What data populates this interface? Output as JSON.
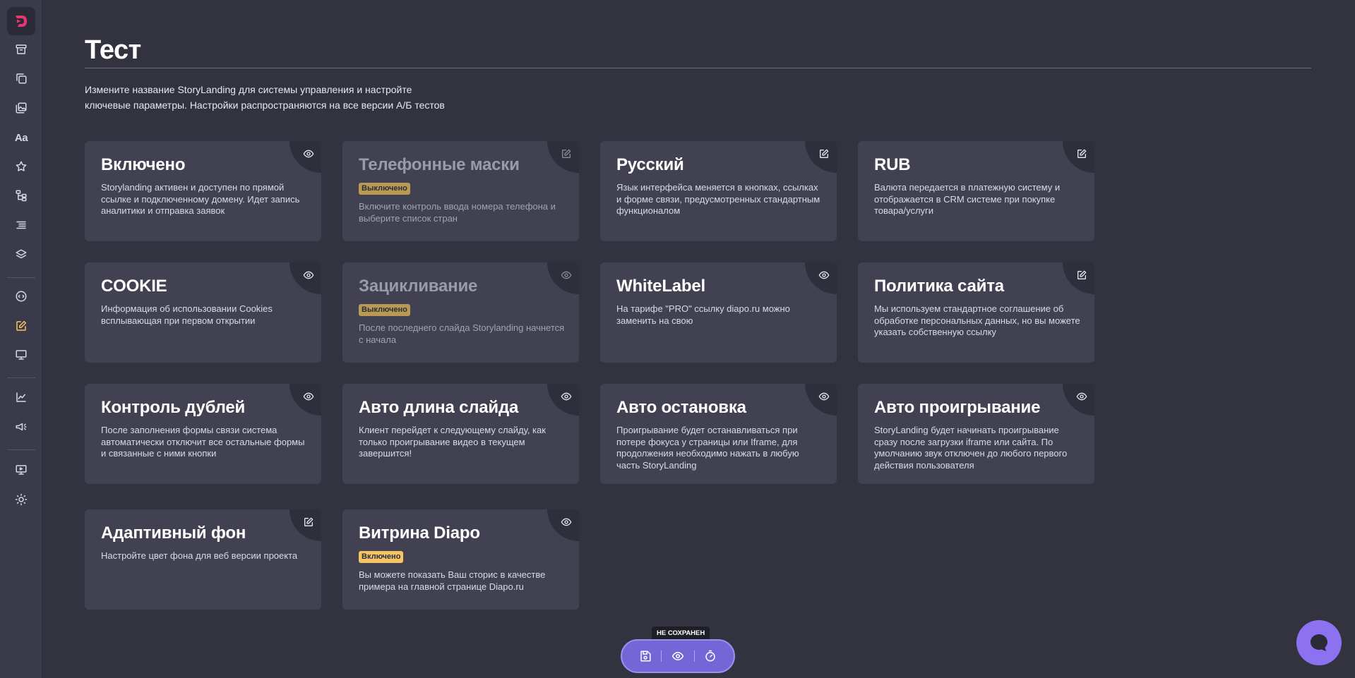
{
  "page": {
    "title": "Тест",
    "description": "Измените название StoryLanding для системы управления и настройте ключевые параметры. Настройки распространяются на все версии А/Б тестов"
  },
  "sidebar": {
    "items": [
      {
        "icon": "archive-icon"
      },
      {
        "icon": "copy-icon"
      },
      {
        "icon": "images-icon"
      },
      {
        "icon": "typography-icon",
        "text": "Aa"
      },
      {
        "icon": "star-icon"
      },
      {
        "icon": "tree-icon"
      },
      {
        "icon": "list-icon"
      },
      {
        "icon": "layers-icon"
      },
      {
        "icon": "code-icon"
      },
      {
        "icon": "edit-icon",
        "active": true
      },
      {
        "icon": "monitor-icon"
      },
      {
        "icon": "chart-icon"
      },
      {
        "icon": "megaphone-icon"
      },
      {
        "icon": "presentation-icon"
      },
      {
        "icon": "sun-icon"
      }
    ]
  },
  "cards": [
    {
      "title": "Включено",
      "desc": "Storylanding активен и доступен по прямой ссылке и подключенному домену. Идет запись аналитики и отправка заявок",
      "action": "eye-icon"
    },
    {
      "title": "Телефонные маски",
      "badge": "Выключено",
      "desc": "Включите контроль ввода номера телефона и выберите список стран",
      "action": "edit-icon",
      "disabled": true
    },
    {
      "title": "Русский",
      "desc": "Язык интерфейса меняется в кнопках, ссылках и форме связи, предусмотренных стандартным функционалом",
      "action": "edit-icon"
    },
    {
      "title": "RUB",
      "desc": "Валюта передается в платежную систему и отображается в CRM системе при покупке товара/услуги",
      "action": "edit-icon"
    },
    {
      "title": "COOKIE",
      "desc": "Информация об использовании Cookies всплывающая при первом открытии",
      "action": "eye-icon"
    },
    {
      "title": "Зацикливание",
      "badge": "Выключено",
      "desc": "После последнего слайда Storylanding начнется с начала",
      "action": "eye-icon",
      "disabled": true
    },
    {
      "title": "WhiteLabel",
      "desc": "На тарифе \"PRO\" ссылку diapo.ru можно заменить на свою",
      "action": "eye-icon"
    },
    {
      "title": "Политика сайта",
      "desc": "Мы используем стандартное соглашение об обработке персональных данных, но вы можете указать собственную ссылку",
      "action": "edit-icon"
    },
    {
      "title": "Контроль дублей",
      "desc": "После заполнения формы связи система автоматически отключит все остальные формы и связанные с ними кнопки",
      "action": "eye-icon"
    },
    {
      "title": "Авто длина слайда",
      "desc": "Клиент перейдет к следующему слайду, как только проигрывание видео в текущем завершится!",
      "action": "eye-icon"
    },
    {
      "title": "Авто остановка",
      "desc": "Проигрывание будет останавливаться при потере фокуса у страницы или Iframe, для продолжения необходимо нажать в любую часть StoryLanding",
      "action": "eye-icon"
    },
    {
      "title": "Авто проигрывание",
      "desc": "StoryLanding будет начинать проигрывание сразу после загрузки iframe или сайта. По умолчанию звук отключен до любого первого действия пользователя",
      "action": "eye-icon"
    },
    {
      "title": "Адаптивный фон",
      "desc": "Настройте цвет фона для веб версии проекта",
      "action": "edit-icon"
    },
    {
      "title": "Витрина Diapo",
      "badge": "Включено",
      "badge_on": true,
      "desc": "Вы можете показать Ваш сторис в качестве примера на главной странице Diapo.ru",
      "action": "eye-icon"
    }
  ],
  "toolbar": {
    "tooltip": "НЕ СОХРАНЕН",
    "buttons": [
      "save-icon",
      "eye-icon",
      "timer-icon"
    ]
  },
  "colors": {
    "background": "#33333f",
    "sidebar": "#3a3a4b",
    "card": "#414152",
    "accent": "#f5c565",
    "toolbar": "#7466d6",
    "chat": "#8c71f1"
  }
}
